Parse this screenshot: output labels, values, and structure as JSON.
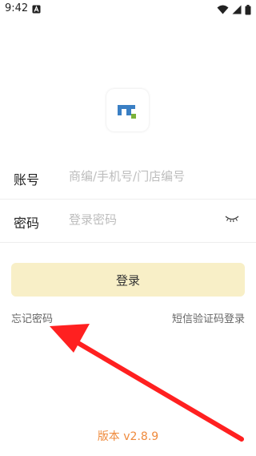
{
  "status_bar": {
    "time": "9:42"
  },
  "form": {
    "account": {
      "label": "账号",
      "placeholder": "商编/手机号/门店编号"
    },
    "password": {
      "label": "密码",
      "placeholder": "登录密码"
    }
  },
  "login_button": {
    "label": "登录"
  },
  "links": {
    "forgot_password": "忘记密码",
    "sms_login": "短信验证码登录"
  },
  "footer": {
    "version_prefix": "版本",
    "version_number": "v2.8.9"
  },
  "colors": {
    "login_button_bg": "#f8efc7",
    "version_text": "#ef8a3c",
    "logo_blue": "#3a7fc4",
    "logo_green": "#7bb23a",
    "annotation_arrow": "#ff2020"
  },
  "icons": {
    "logo": "app-logo-icon",
    "password_toggle": "eye-closed-icon",
    "wifi": "wifi-icon",
    "signal": "signal-icon",
    "battery": "battery-icon",
    "notification": "notification-a-icon"
  }
}
